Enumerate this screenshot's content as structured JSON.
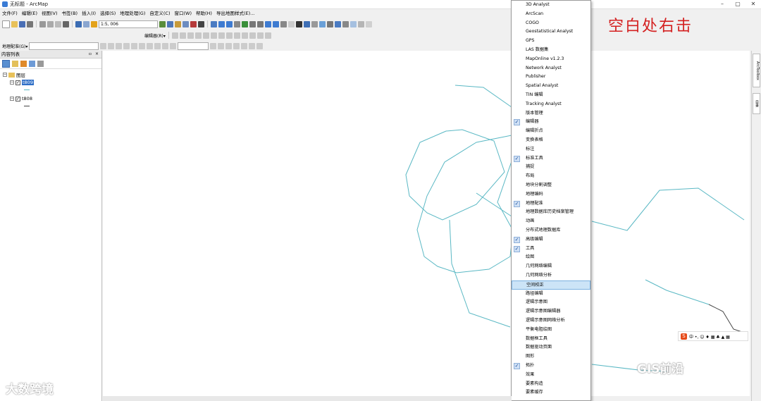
{
  "window": {
    "title": "无标题 - ArcMap"
  },
  "menubar": [
    "文件(F)",
    "编辑(E)",
    "视图(V)",
    "书签(B)",
    "插入(I)",
    "选择(S)",
    "地理处理(G)",
    "自定义(C)",
    "窗口(W)",
    "帮助(H)",
    "导出地图样式(E)..."
  ],
  "toolbar": {
    "scale": "1:5, 006",
    "editor_label": "编辑器(R)▾",
    "georef_label": "地理配准(G)▾"
  },
  "toc": {
    "title": "内容列表",
    "pin": "▫",
    "close": "×",
    "layers_label": "图层",
    "layer1": "t809",
    "layer2": "t808"
  },
  "context_menu": {
    "items": [
      {
        "label": "3D Analyst",
        "checked": false
      },
      {
        "label": "ArcScan",
        "checked": false
      },
      {
        "label": "COGO",
        "checked": false
      },
      {
        "label": "Geostatistical Analyst",
        "checked": false
      },
      {
        "label": "GPS",
        "checked": false
      },
      {
        "label": "LAS 数据集",
        "checked": false
      },
      {
        "label": "MapOnline v1.2.3",
        "checked": false
      },
      {
        "label": "Network Analyst",
        "checked": false
      },
      {
        "label": "Publisher",
        "checked": false
      },
      {
        "label": "Spatial Analyst",
        "checked": false
      },
      {
        "label": "TIN 编辑",
        "checked": false
      },
      {
        "label": "Tracking Analyst",
        "checked": false
      },
      {
        "label": "版本管理",
        "checked": false
      },
      {
        "label": "编辑器",
        "checked": true
      },
      {
        "label": "编辑折点",
        "checked": false
      },
      {
        "label": "变换表格",
        "checked": false
      },
      {
        "label": "标注",
        "checked": false
      },
      {
        "label": "标准工具",
        "checked": true
      },
      {
        "label": "捕捉",
        "checked": false
      },
      {
        "label": "布局",
        "checked": false
      },
      {
        "label": "地块分割调整",
        "checked": false
      },
      {
        "label": "地理编码",
        "checked": false
      },
      {
        "label": "地理配准",
        "checked": true
      },
      {
        "label": "地理数据库历史档案管理",
        "checked": false
      },
      {
        "label": "动画",
        "checked": false
      },
      {
        "label": "分布式地理数据库",
        "checked": false
      },
      {
        "label": "高级编辑",
        "checked": true
      },
      {
        "label": "工具",
        "checked": true
      },
      {
        "label": "绘图",
        "checked": false
      },
      {
        "label": "几何网络编辑",
        "checked": false
      },
      {
        "label": "几何网络分析",
        "checked": false
      },
      {
        "label": "空间校正",
        "checked": false,
        "highlight": true
      },
      {
        "label": "路径编辑",
        "checked": false
      },
      {
        "label": "逻辑示意图",
        "checked": false
      },
      {
        "label": "逻辑示意图编辑器",
        "checked": false
      },
      {
        "label": "逻辑示意图网络分析",
        "checked": false
      },
      {
        "label": "平衡电阻绘图",
        "checked": false
      },
      {
        "label": "数据框工具",
        "checked": false
      },
      {
        "label": "数据驱动页面",
        "checked": false
      },
      {
        "label": "图形",
        "checked": false
      },
      {
        "label": "拓扑",
        "checked": true
      },
      {
        "label": "效果",
        "checked": false
      },
      {
        "label": "要素构造",
        "checked": false
      },
      {
        "label": "要素缓存",
        "checked": false
      }
    ]
  },
  "annotation": "空白处右击",
  "ime": {
    "logo": "S",
    "text": "中 •, ☺ ♦ ▦ ♣ ▲ ▦"
  },
  "watermarks": {
    "left": "大数跨境",
    "right": "GIS前沿"
  },
  "side_tabs": [
    "ArcToolbox",
    "目录"
  ],
  "colors": {
    "line": "#5ab8c4",
    "dark_line": "#444444",
    "annotation": "#d42020",
    "highlight": "#cce4f7"
  }
}
